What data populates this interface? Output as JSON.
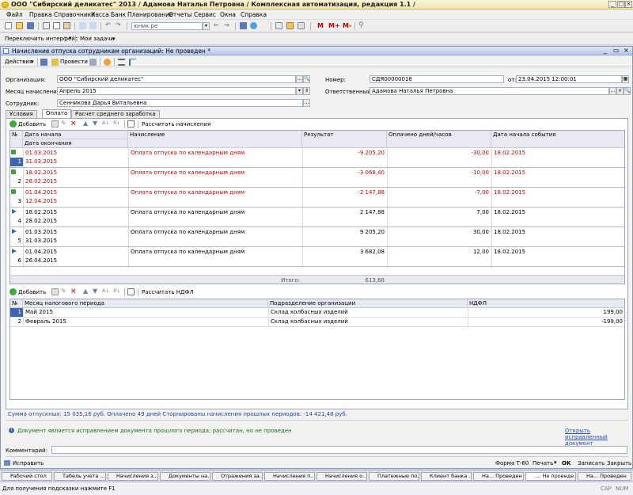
{
  "app": {
    "title": "ООО \"Сибирский деликатес\" 2013 / Адамова Наталья Петровна / Комплексная автоматизация, редакция 1.1 /"
  },
  "menu": [
    "Файл",
    "Правка",
    "Справочники",
    "Касса",
    "Банк",
    "Планирование",
    "Отчеты",
    "Сервис",
    "Окна",
    "Справка"
  ],
  "toolbar": {
    "search_value": "юник.ре",
    "m_label": "M",
    "mplus_label": "M+",
    "mminus_label": "M-",
    "switch_interface": "Переключить интерфейс",
    "my_tasks": "Мои задачи"
  },
  "document": {
    "title": "Начисление отпуска сотрудникам организаций: Не проведен *",
    "actions_label": "Действия",
    "post_label": "Провести",
    "org_label": "Организация:",
    "org_value": "ООО \"Сибирский деликатес\"",
    "month_label": "Месяц начисления:",
    "month_value": "Апрель 2015",
    "employee_label": "Сотрудник:",
    "employee_value": "Сенникова Дарья Витальевна",
    "number_label": "Номер:",
    "number_value": "СДЯ00000018",
    "from_label": "от:",
    "date_value": "23.04.2015 12:00:01",
    "responsible_label": "Ответственный:",
    "responsible_value": "Адамова Наталья Петровна",
    "tabs": [
      "Условия",
      "Оплата",
      "Расчет среднего заработка"
    ]
  },
  "pay_grid": {
    "add_label": "Добавить",
    "calc_label": "Рассчитать начисления",
    "headers": {
      "num": "№",
      "date_start": "Дата начала",
      "date_end": "Дата окончания",
      "accrual": "Начисление",
      "result": "Результат",
      "paid_days": "Оплачено дней/часов",
      "event_date": "Дата начала события"
    },
    "rows": [
      {
        "num": "1",
        "start": "01.03.2015",
        "end": "31.03.2015",
        "accrual": "Оплата отпуска по календарным дням",
        "result": "-9 205,20",
        "days": "-30,00",
        "event": "18.02.2015",
        "storno": true
      },
      {
        "num": "2",
        "start": "18.02.2015",
        "end": "28.02.2015",
        "accrual": "Оплата отпуска по календарным дням",
        "result": "-3 068,40",
        "days": "-10,00",
        "event": "18.02.2015",
        "storno": true
      },
      {
        "num": "3",
        "start": "01.04.2015",
        "end": "12.04.2015",
        "accrual": "Оплата отпуска по календарным дням",
        "result": "-2 147,88",
        "days": "-7,00",
        "event": "18.02.2015",
        "storno": true
      },
      {
        "num": "4",
        "start": "18.02.2015",
        "end": "28.02.2015",
        "accrual": "Оплата отпуска по календарным дням",
        "result": "2 147,88",
        "days": "7,00",
        "event": "18.02.2015",
        "storno": false
      },
      {
        "num": "5",
        "start": "01.03.2015",
        "end": "31.03.2015",
        "accrual": "Оплата отпуска по календарным дням",
        "result": "9 205,20",
        "days": "30,00",
        "event": "18.02.2015",
        "storno": false
      },
      {
        "num": "6",
        "start": "01.04.2015",
        "end": "26.04.2015",
        "accrual": "Оплата отпуска по календарным дням",
        "result": "3 682,08",
        "days": "12,00",
        "event": "18.02.2015",
        "storno": false
      }
    ],
    "total_label": "Итого:",
    "total_value": "613,68"
  },
  "ndfl_grid": {
    "add_label": "Добавить",
    "calc_label": "Рассчитать НДФЛ",
    "headers": {
      "num": "№",
      "month": "Месяц налогового периода",
      "dept": "Подразделение организации",
      "ndfl": "НДФЛ"
    },
    "rows": [
      {
        "num": "1",
        "month": "Май 2015",
        "dept": "Склад колбасных изделий",
        "ndfl": "199,00"
      },
      {
        "num": "2",
        "month": "Февраль 2015",
        "dept": "Склад колбасных изделий",
        "ndfl": "-199,00"
      }
    ]
  },
  "summary": "Сумма отпускных: 15 035,16 руб. Оплачено 49 дней Сторнированы начисления прошлых периодов: -14 421,48 руб.",
  "info_text": "Документ является исправлением документа прошлого периода; рассчитан, но не проведен",
  "open_corrected_link": "Открыть исправленный документ",
  "comment_label": "Комментарий:",
  "bottom_buttons": {
    "fix": "Исправить",
    "form": "Форма Т-60",
    "print": "Печать",
    "ok": "OK",
    "save": "Записать",
    "close": "Закрыть"
  },
  "taskbar": [
    "Рабочий стол",
    "Табель учета ...",
    "Начисления з...",
    "Документы на...",
    "Отражения за...",
    "Начисления п...",
    "Начисления о...",
    "Платежные по...",
    "Клиент банка ...",
    "На... Проведен",
    "...: Не проведе...",
    "На... Проведен"
  ],
  "status": {
    "hint": "Для получения подсказки нажмите F1",
    "cap": "CAP",
    "num": "NUM"
  }
}
